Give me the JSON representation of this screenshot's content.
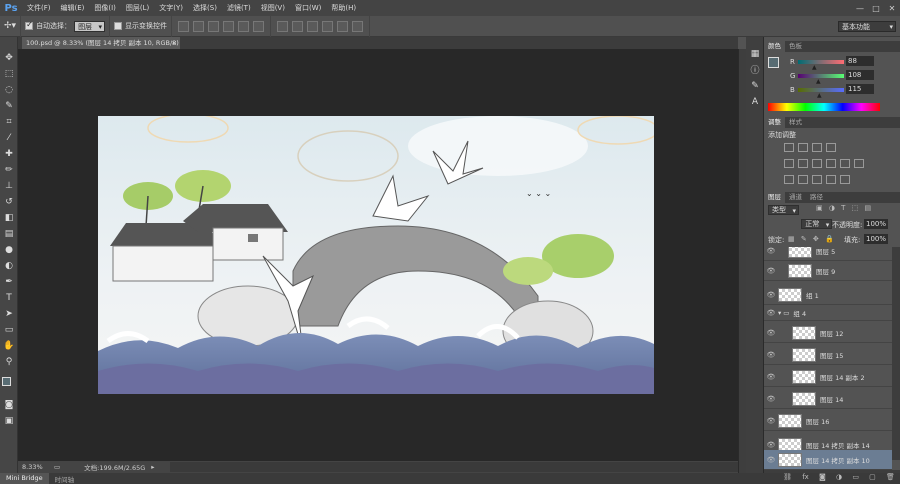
{
  "menubar": {
    "logo": "Ps",
    "items": [
      "文件(F)",
      "编辑(E)",
      "图像(I)",
      "图层(L)",
      "文字(Y)",
      "选择(S)",
      "滤镜(T)",
      "视图(V)",
      "窗口(W)",
      "帮助(H)"
    ],
    "window_controls": [
      "—",
      "□",
      "✕"
    ]
  },
  "options": {
    "auto_select_label": "自动选择：",
    "auto_select_value": "图层",
    "show_transform_label": "显示变换控件",
    "workspace": "基本功能"
  },
  "document": {
    "tab_title": "100.psd @ 8.33% (图层 14 拷贝 副本 10, RGB/8)",
    "tab_close": "×"
  },
  "status": {
    "zoom": "8.33%",
    "doc_info": "文档:199.6M/2.65G"
  },
  "bottom_tabs": [
    "Mini Bridge",
    "时间轴"
  ],
  "color_panel": {
    "tabs": [
      "颜色",
      "色板"
    ],
    "r_label": "R",
    "r_value": "88",
    "g_label": "G",
    "g_value": "108",
    "b_label": "B",
    "b_value": "115",
    "r_level": 0.345,
    "g_level": 0.424,
    "b_level": 0.451,
    "fg_color": "#586c73"
  },
  "adjust_panel": {
    "tabs": [
      "调整",
      "样式"
    ],
    "title": "添加调整"
  },
  "layers_panel": {
    "tabs": [
      "图层",
      "通道",
      "路径"
    ],
    "filter_kind": "类型",
    "blend_mode": "正常",
    "opacity_label": "不透明度:",
    "opacity_value": "100%",
    "lock_label": "锁定:",
    "fill_label": "填充:",
    "fill_value": "100%",
    "layers": [
      {
        "name": "图层 5"
      },
      {
        "name": "图层 9"
      },
      {
        "name": "组 1"
      },
      {
        "name": "组 4"
      },
      {
        "name": "图层 12"
      },
      {
        "name": "图层 15"
      },
      {
        "name": "图层 14 副本 2"
      },
      {
        "name": "图层 14"
      },
      {
        "name": "图层 16"
      },
      {
        "name": "图层 14 拷贝 副本 14"
      },
      {
        "name": "图层 14 拷贝 副本 10"
      }
    ]
  }
}
